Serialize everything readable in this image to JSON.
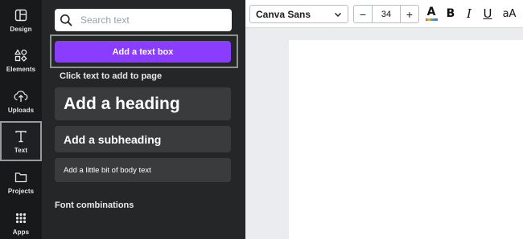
{
  "rail": {
    "items": [
      {
        "label": "Design",
        "icon": "design-icon"
      },
      {
        "label": "Elements",
        "icon": "elements-icon"
      },
      {
        "label": "Uploads",
        "icon": "upload-icon"
      },
      {
        "label": "Text",
        "icon": "text-icon",
        "active": true
      },
      {
        "label": "Projects",
        "icon": "folder-icon"
      },
      {
        "label": "Apps",
        "icon": "apps-icon"
      }
    ]
  },
  "panel": {
    "search_placeholder": "Search text",
    "add_text_box": "Add a text box",
    "hint": "Click text to add to page",
    "cards": {
      "heading": "Add a heading",
      "subheading": "Add a subheading",
      "body": "Add a little bit of body text"
    },
    "section_title": "Font combinations"
  },
  "toolbar": {
    "font_name": "Canva Sans",
    "font_size": "34",
    "minus": "−",
    "plus": "+",
    "color_glyph": "A",
    "bold": "B",
    "italic": "I",
    "underline": "U",
    "case": "aA"
  },
  "colors": {
    "accent": "#8b3dff",
    "rail_bg": "#18191b",
    "panel_bg": "#252627",
    "card_bg": "#3a3b3d",
    "workspace_bg": "#ebecf0"
  }
}
